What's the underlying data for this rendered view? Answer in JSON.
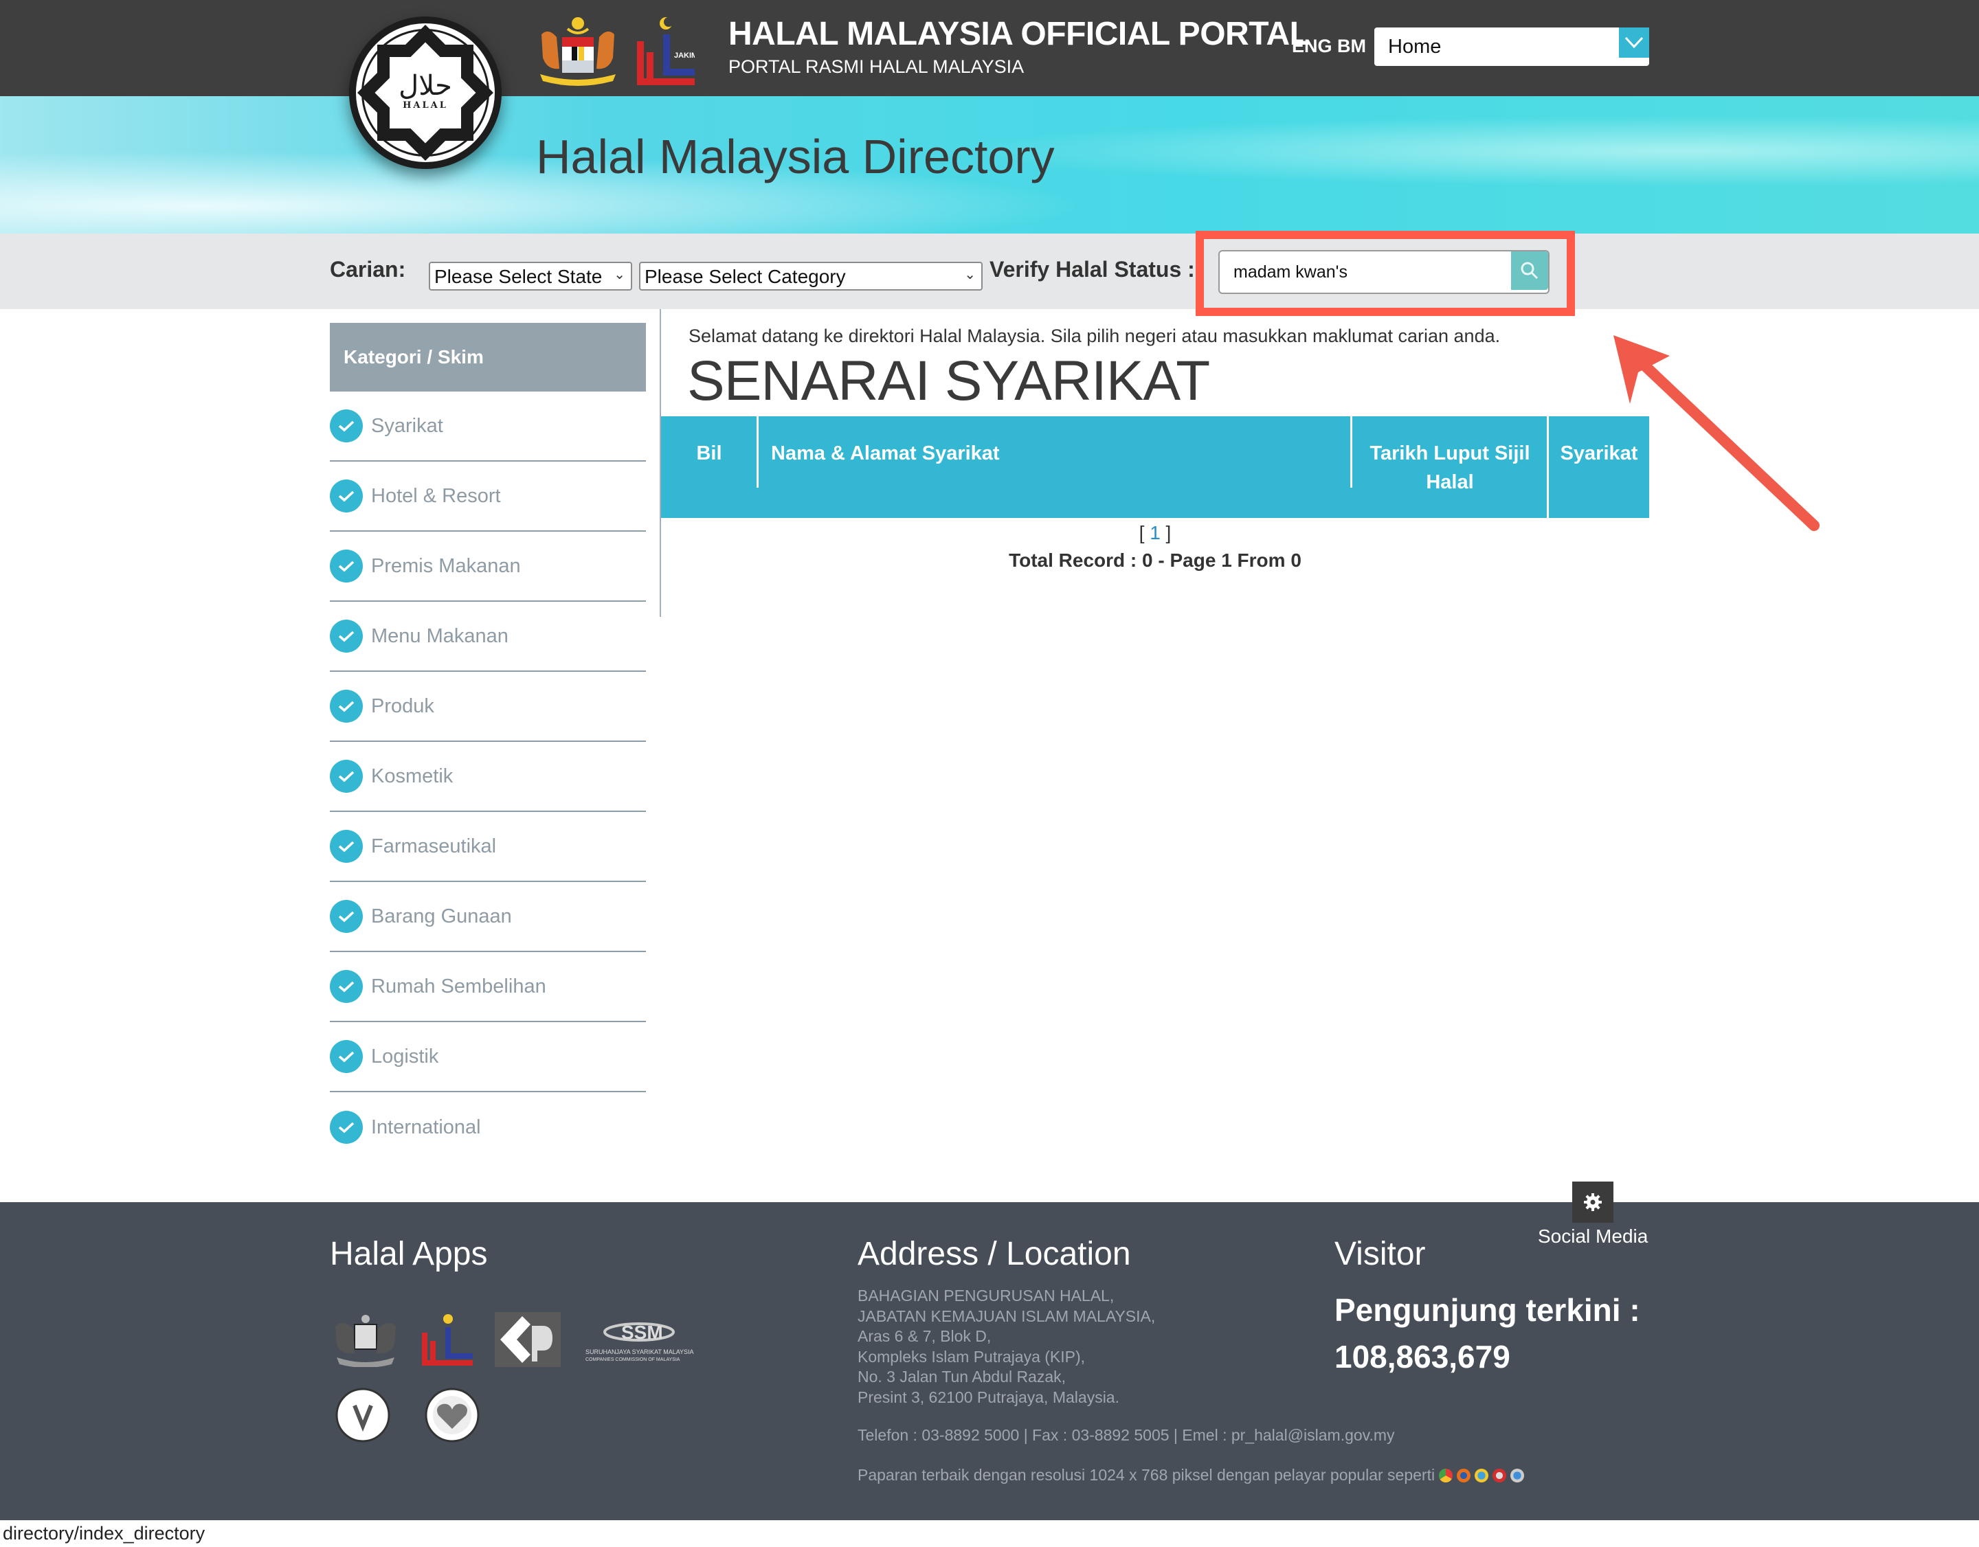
{
  "header": {
    "portal_title": "HALAL MALAYSIA OFFICIAL PORTAL",
    "portal_subtitle": "PORTAL RASMI HALAL MALAYSIA",
    "lang_eng": "ENG",
    "lang_bm": "BM",
    "nav_select_value": "Home",
    "logo_halal_text": "HALAL",
    "logo_arabic": "حلال",
    "jakim_label": "JAKIM"
  },
  "banner": {
    "title": "Halal Malaysia Directory"
  },
  "search": {
    "label": "Carian:",
    "state_select": "Please Select State",
    "category_select": "Please Select Category",
    "verify_label": "Verify Halal Status :",
    "query_value": "madam kwan's"
  },
  "sidebar": {
    "header": "Kategori / Skim",
    "items": [
      {
        "label": "Syarikat"
      },
      {
        "label": "Hotel & Resort"
      },
      {
        "label": "Premis Makanan"
      },
      {
        "label": "Menu Makanan"
      },
      {
        "label": "Produk"
      },
      {
        "label": "Kosmetik"
      },
      {
        "label": "Farmaseutikal"
      },
      {
        "label": "Barang Gunaan"
      },
      {
        "label": "Rumah Sembelihan"
      },
      {
        "label": "Logistik"
      },
      {
        "label": "International"
      }
    ]
  },
  "content": {
    "welcome": "Selamat datang ke direktori Halal Malaysia. Sila pilih negeri atau masukkan maklumat carian anda.",
    "heading": "SENARAI SYARIKAT",
    "table": {
      "columns": [
        "Bil",
        "Nama & Alamat Syarikat",
        "Tarikh Luput Sijil Halal",
        "Syarikat"
      ],
      "rows": []
    },
    "pager_open": "[ ",
    "pager_page": "1",
    "pager_close": " ]",
    "total_record": "Total Record : 0 - Page 1 From 0"
  },
  "footer": {
    "apps_title": "Halal Apps",
    "address_title": "Address / Location",
    "address_lines": [
      "BAHAGIAN PENGURUSAN HALAL,",
      "JABATAN KEMAJUAN ISLAM MALAYSIA,",
      "Aras 6 & 7, Blok D,",
      "Kompleks Islam Putrajaya (KIP),",
      "No. 3 Jalan Tun Abdul Razak,",
      "Presint 3, 62100 Putrajaya, Malaysia."
    ],
    "contact": "Telefon : 03-8892 5000 | Fax : 03-8892 5005 | Emel : pr_halal@islam.gov.my",
    "best_view": "Paparan terbaik dengan resolusi 1024 x 768 piksel dengan pelayar popular seperti",
    "visitor_title": "Visitor",
    "visitor_label": "Pengunjung terkini :",
    "visitor_count": "108,863,679",
    "social_label": "Social Media",
    "ssm_text_1": "SURUHANJAYA SYARIKAT MALAYSIA",
    "ssm_text_2": "COMPANIES COMMISSION OF MALAYSIA"
  },
  "statusbar": {
    "url": "directory/index_directory"
  },
  "colors": {
    "accent": "#34b7d2",
    "topbar": "#3f3f3f",
    "footer": "#474e58",
    "highlight": "#ff5a4a",
    "sidebar_header": "#95a3ad"
  }
}
